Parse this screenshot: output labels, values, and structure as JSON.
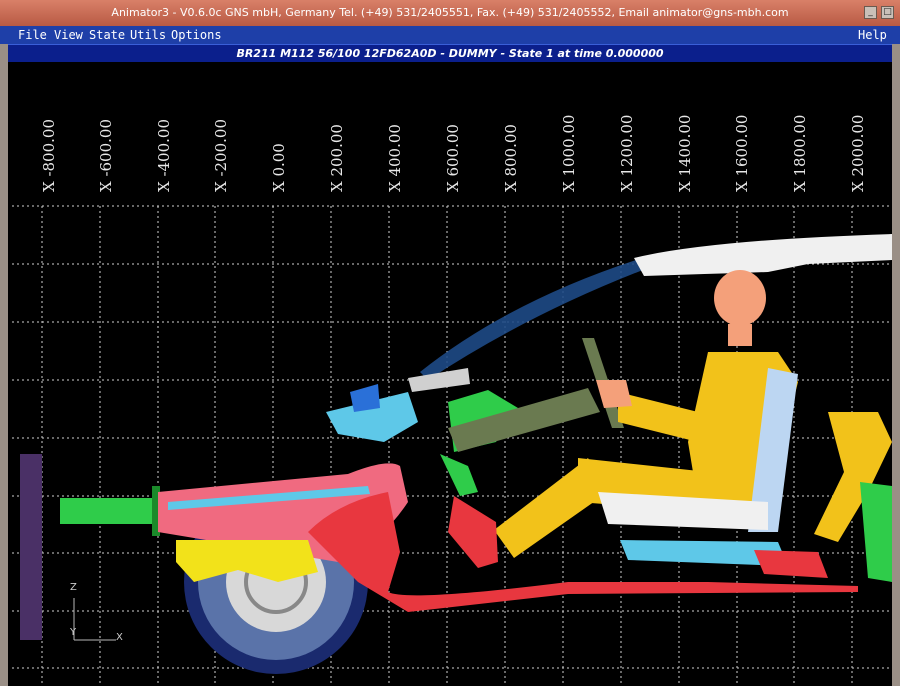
{
  "window": {
    "title": "Animator3 - V0.6.0c GNS mbH, Germany Tel. (+49) 531/2405551, Fax. (+49) 531/2405552, Email animator@gns-mbh.com",
    "minimize_symbol": "_",
    "maximize_symbol": "□"
  },
  "menu": {
    "items": [
      "File",
      "View",
      "State",
      "Utils",
      "Options"
    ],
    "help": "Help"
  },
  "status": {
    "text": "BR211 M112 56/100 12FD62A0D - DUMMY - State 1 at time 0.000000"
  },
  "viewport": {
    "x_axis_labels": [
      "X -800.00",
      "X -600.00",
      "X -400.00",
      "X -200.00",
      "X 0.00",
      "X 200.00",
      "X 400.00",
      "X 600.00",
      "X 800.00",
      "X 1000.00",
      "X 1200.00",
      "X 1400.00",
      "X 1600.00",
      "X 1800.00",
      "X 2000.00"
    ],
    "triad": {
      "z": "Z",
      "y": "Y",
      "x": "X"
    },
    "grid_color": "#cfcfcf",
    "part_colors": {
      "body_red": "#e8373f",
      "pink": "#f06a80",
      "light_blue": "#5ec8e8",
      "dummy_yellow": "#f2c21a",
      "green": "#2fcc4a",
      "white": "#f0f0f0",
      "head_skin": "#f4a07a",
      "seat_light": "#bcd6f2",
      "tire_blue": "#2a3a8a",
      "purple": "#4a3066"
    }
  }
}
